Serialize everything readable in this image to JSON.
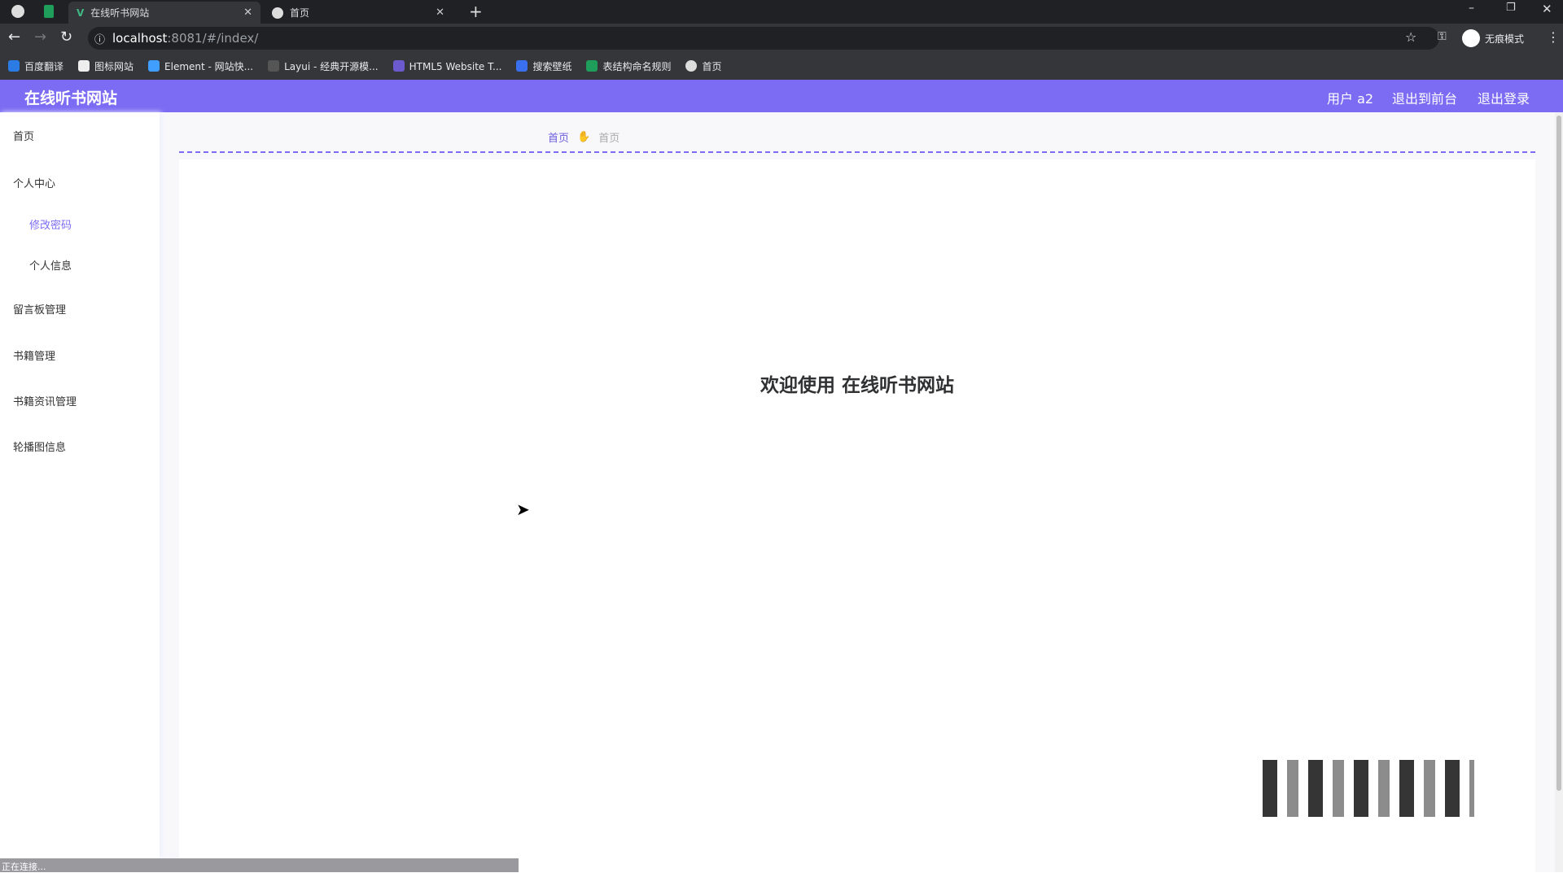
{
  "browser": {
    "tabs": [
      {
        "title": "在线听书网站",
        "active": true
      },
      {
        "title": "首页",
        "active": false
      }
    ],
    "url_host": "localhost",
    "url_rest": ":8081/#/index/",
    "profile_label": "无痕模式",
    "bookmarks": [
      {
        "label": "百度翻译",
        "color": "#2a7be4"
      },
      {
        "label": "图标网站",
        "color": "#222222"
      },
      {
        "label": "Element - 网站快...",
        "color": "#409eff"
      },
      {
        "label": "Layui - 经典开源模...",
        "color": "#555555"
      },
      {
        "label": "HTML5 Website T...",
        "color": "#6a5acd"
      },
      {
        "label": "搜索壁纸",
        "color": "#3a6ff0"
      },
      {
        "label": "表结构命名规则",
        "color": "#1e9e5a"
      },
      {
        "label": "首页",
        "color": "#9aa0a6"
      }
    ],
    "status_text": "正在连接..."
  },
  "app": {
    "title": "在线听书网站",
    "accent": "#7b6cf3",
    "user_label": "用户 a2",
    "front_label": "退出到前台",
    "logout_label": "退出登录"
  },
  "sidebar": {
    "items": [
      {
        "label": "首页"
      },
      {
        "label": "个人中心"
      },
      {
        "label": "修改密码",
        "sub": true,
        "active": true
      },
      {
        "label": "个人信息",
        "sub": true
      },
      {
        "label": "留言板管理"
      },
      {
        "label": "书籍管理"
      },
      {
        "label": "书籍资讯管理"
      },
      {
        "label": "轮播图信息"
      }
    ]
  },
  "breadcrumb": {
    "home": "首页",
    "current": "首页"
  },
  "main": {
    "welcome": "欢迎使用 在线听书网站"
  }
}
